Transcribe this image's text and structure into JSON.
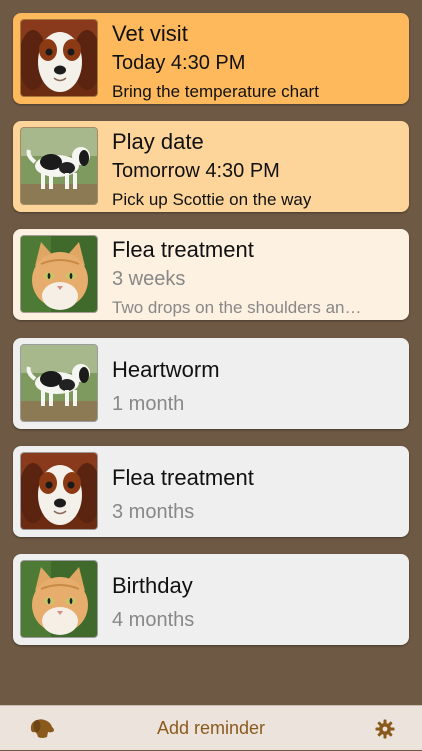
{
  "colors": {
    "background": "#6e5944",
    "card_today": "#fdb95c",
    "card_tomorrow": "#fdd59a",
    "card_soon": "#fdf1e2",
    "card_later": "#efefef",
    "accent_brown": "#8a5a1c"
  },
  "reminders": [
    {
      "title": "Vet visit",
      "when": "Today 4:30 PM",
      "note": "Bring the temperature chart",
      "pet_icon": "spaniel-portrait"
    },
    {
      "title": "Play date",
      "when": "Tomorrow 4:30 PM",
      "note": "Pick up Scottie on the way",
      "pet_icon": "spaniel-standing"
    },
    {
      "title": "Flea treatment",
      "when": "3 weeks",
      "note": "Two drops on the shoulders an…",
      "pet_icon": "cat-portrait"
    },
    {
      "title": "Heartworm",
      "when": "1 month",
      "pet_icon": "spaniel-standing"
    },
    {
      "title": "Flea treatment",
      "when": "3 months",
      "pet_icon": "spaniel-portrait"
    },
    {
      "title": "Birthday",
      "when": "4 months",
      "pet_icon": "cat-portrait"
    }
  ],
  "toolbar": {
    "add_label": "Add reminder",
    "left_icon": "dog-head-icon",
    "right_icon": "gear-icon"
  }
}
